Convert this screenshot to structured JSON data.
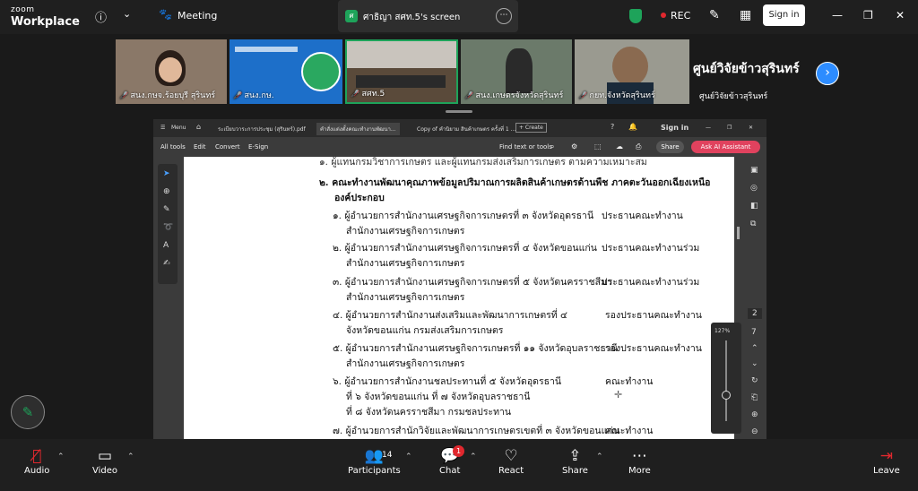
{
  "topbar": {
    "logo_line1": "zoom",
    "logo_line2": "Workplace",
    "meeting_label": "Meeting",
    "screen_share_avatar": "ศ",
    "screen_share_title": "ศาธิญา สศท.5's screen",
    "rec_label": "REC",
    "sign_in": "Sign in"
  },
  "participants_strip": {
    "tiles": [
      {
        "name": "สนง.กษจ.ร้อยบุรี สุรินทร์",
        "color": "#7a6a60"
      },
      {
        "name": "สนง.กษ.",
        "color": "#1d6fc9"
      },
      {
        "name": "สศท.5",
        "color": "#5a4a3a"
      },
      {
        "name": "สนง.เกษตรจังหวัดสุรินทร์",
        "color": "#6b7a6a"
      },
      {
        "name": "กยท.จังหวัดสุรินทร์",
        "color": "#8a8a80"
      }
    ],
    "last_name": "ศูนย์วิจัยข้าวสุรินทร์",
    "last_name_small": "ศูนย์วิจัยข้าวสุรินทร์"
  },
  "pdf": {
    "tab1": "ระเบียบวาระการประชุม (สุรินทร์).pdf",
    "tab2": "คำสั่งแต่งตั้งคณะทำงานพัฒนา...",
    "tab3": "Copy of คำนิยาม สินค้าเกษตร ครั้งที่ 1 ...",
    "create": "+ Create",
    "sign_in": "Sign in",
    "menu": "Menu",
    "all_tools": "All tools",
    "edit": "Edit",
    "convert": "Convert",
    "esign": "E-Sign",
    "find": "Find text or tools",
    "share": "Share",
    "ai": "Ask AI Assistant",
    "zoom_pct": "127%",
    "page_num": "2",
    "total_pages": "7"
  },
  "document": {
    "line0": "๑. ผู้แทนกรมวิชาการเกษตร และผู้แทนกรมส่งเสริมการเกษตร ตามความเหมาะสม",
    "heading1": "๒. คณะทำงานพัฒนาคุณภาพข้อมูลปริมาณการผลิตสินค้าเกษตรด้านพืช ภาคตะวันออกเฉียงเหนือ",
    "heading2": "องค์ประกอบ",
    "items": [
      {
        "a": "๑. ผู้อำนวยการสำนักงานเศรษฐกิจการเกษตรที่ ๓ จังหวัดอุดรธานี",
        "b": "สำนักงานเศรษฐกิจการเกษตร",
        "role": "ประธานคณะทำงาน"
      },
      {
        "a": "๒. ผู้อำนวยการสำนักงานเศรษฐกิจการเกษตรที่ ๔ จังหวัดขอนแก่น",
        "b": "สำนักงานเศรษฐกิจการเกษตร",
        "role": "ประธานคณะทำงานร่วม"
      },
      {
        "a": "๓. ผู้อำนวยการสำนักงานเศรษฐกิจการเกษตรที่ ๕ จังหวัดนครราชสีมา",
        "b": "สำนักงานเศรษฐกิจการเกษตร",
        "role": "ประธานคณะทำงานร่วม"
      },
      {
        "a": "๔. ผู้อำนวยการสำนักงานส่งเสริมและพัฒนาการเกษตรที่ ๔",
        "b": "จังหวัดขอนแก่น กรมส่งเสริมการเกษตร",
        "role": "รองประธานคณะทำงาน"
      },
      {
        "a": "๕. ผู้อำนวยการสำนักงานเศรษฐกิจการเกษตรที่ ๑๑ จังหวัดอุบลราชธานี",
        "b": "สำนักงานเศรษฐกิจการเกษตร",
        "role": "รองประธานคณะทำงาน"
      },
      {
        "a": "๖. ผู้อำนวยการสำนักงานชลประทานที่ ๕ จังหวัดอุดรธานี",
        "b": "ที่ ๖ จังหวัดขอนแก่น ที่ ๗ จังหวัดอุบลราชธานี",
        "c": "ที่ ๘ จังหวัดนครราชสีมา กรมชลประทาน",
        "role": "คณะทำงาน"
      },
      {
        "a": "๗. ผู้อำนวยการสำนักวิจัยและพัฒนาการเกษตรเขตที่ ๓ จังหวัดขอนแก่น",
        "role": "คณะทำงาน"
      }
    ]
  },
  "bottombar": {
    "audio": "Audio",
    "video": "Video",
    "participants": "Participants",
    "participants_count": "14",
    "chat": "Chat",
    "chat_badge": "1",
    "react": "React",
    "share": "Share",
    "more": "More",
    "leave": "Leave"
  }
}
